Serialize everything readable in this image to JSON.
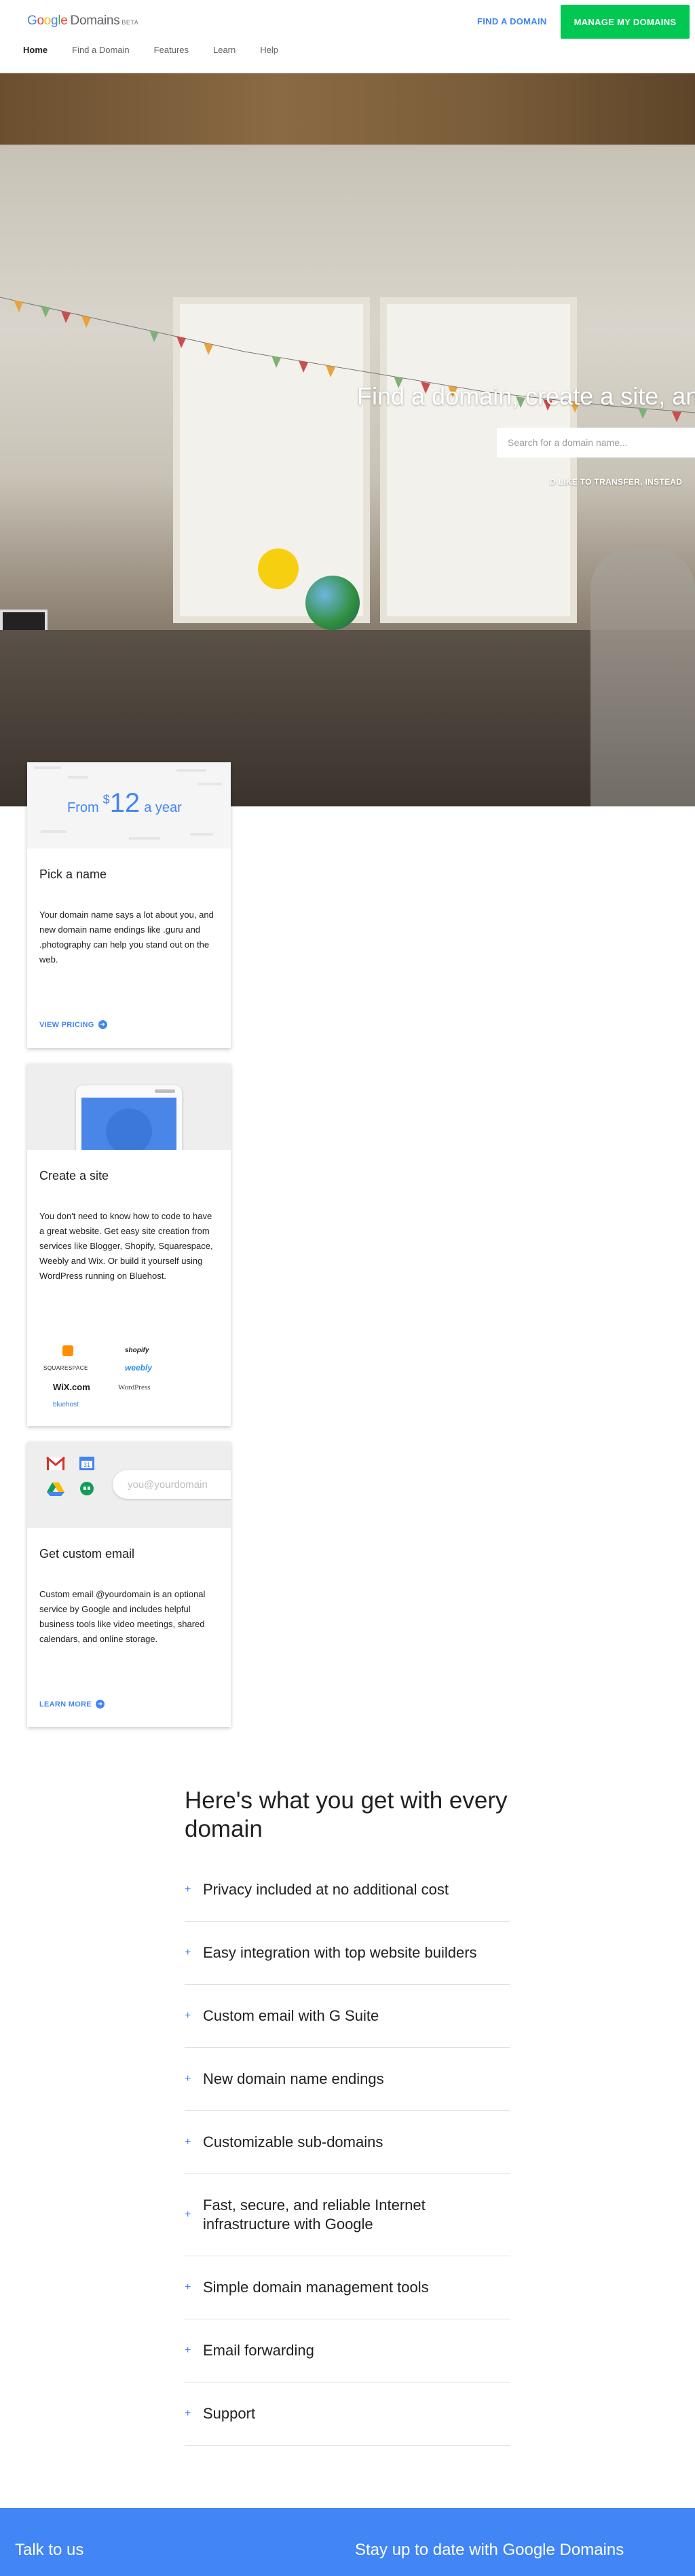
{
  "header": {
    "logo": {
      "letters": [
        "G",
        "o",
        "o",
        "g",
        "l",
        "e"
      ],
      "word": "Domains",
      "badge": "BETA"
    },
    "find_domain": "FIND A DOMAIN",
    "manage_domains": "MANAGE MY DOMAINS",
    "nav": [
      "Home",
      "Find a Domain",
      "Features",
      "Learn",
      "Help"
    ]
  },
  "hero": {
    "title": "Find a domain, create a site, and",
    "search_placeholder": "Search for a domain name...",
    "transfer_link": "D LIKE TO TRANSFER, INSTEAD"
  },
  "cards": {
    "pick": {
      "price_from": "From",
      "price_currency": "$",
      "price_amount": "12",
      "price_period": "a year",
      "title": "Pick a name",
      "body": "Your domain name says a lot about you, and new domain name endings like .guru and .photography can help you stand out on the web.",
      "cta": "VIEW PRICING"
    },
    "site": {
      "title": "Create a site",
      "body": "You don't need to know how to code to have a great website. Get easy site creation from services like Blogger, Shopify, Squarespace, Weebly and Wix. Or build it yourself using WordPress running on Bluehost.",
      "logos": [
        "shopify",
        "SQUARESPACE",
        "weebly",
        "WiX.com",
        "WordPress",
        "bluehost"
      ]
    },
    "email": {
      "field_placeholder": "you@yourdomain",
      "title": "Get custom email",
      "body": "Custom email @yourdomain is an optional service by Google and includes helpful business tools like video meetings, shared calendars, and online storage.",
      "cta": "LEARN MORE"
    }
  },
  "benefits": {
    "heading": "Here's what you get with every domain",
    "items": [
      "Privacy included at no additional cost",
      "Easy integration with top website builders",
      "Custom email with G Suite",
      "New domain name endings",
      "Customizable sub-domains",
      "Fast, secure, and reliable Internet infrastructure with Google",
      "Simple domain management tools",
      "Email forwarding",
      "Support"
    ]
  },
  "footer": {
    "talk": "Talk to us",
    "stay": "Stay up to date with Google Domains"
  },
  "colors": {
    "brand_blue": "#4285f4",
    "manage_green": "#00c853"
  }
}
